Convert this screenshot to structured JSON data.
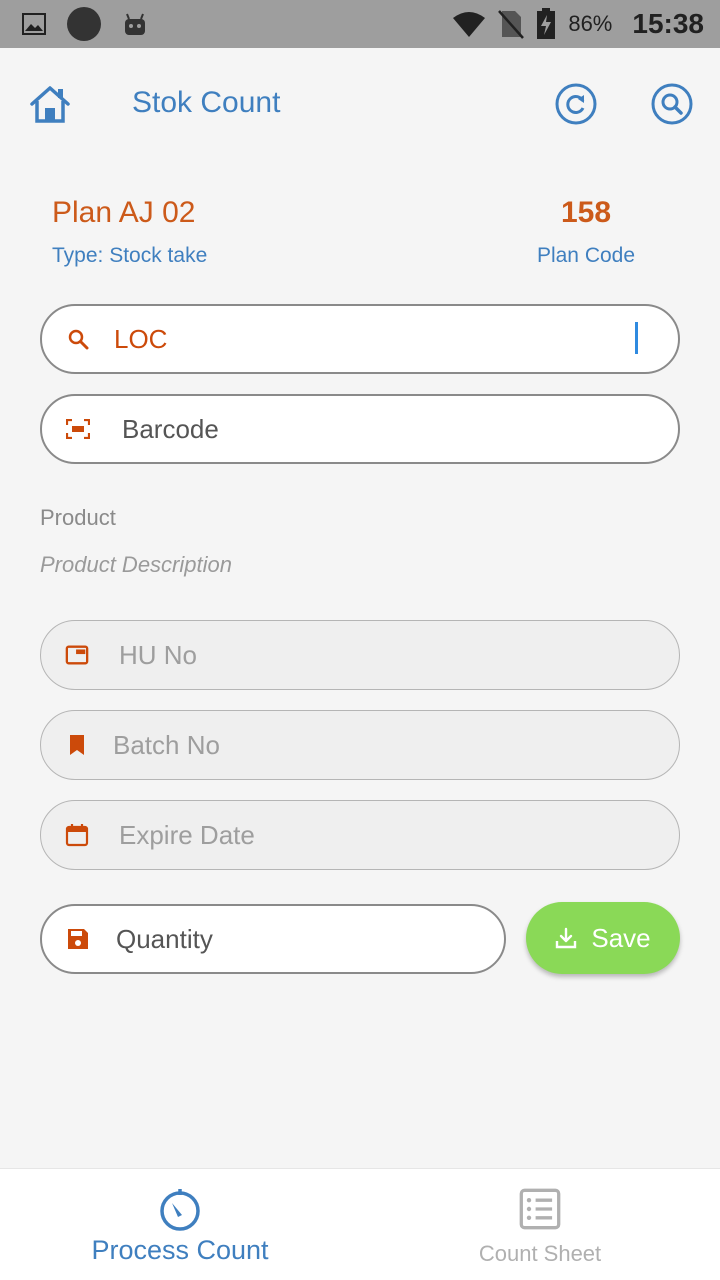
{
  "status_bar": {
    "battery_percent": "86%",
    "time": "15:38"
  },
  "app_bar": {
    "title": "Stok Count"
  },
  "plan": {
    "name": "Plan AJ 02",
    "type": "Type: Stock take",
    "code_value": "158",
    "code_label": "Plan Code"
  },
  "form": {
    "location_value": "LOC",
    "barcode_placeholder": "Barcode",
    "product_label": "Product",
    "product_description": "Product Description",
    "hu_placeholder": "HU No",
    "batch_placeholder": "Batch No",
    "expire_placeholder": "Expire Date",
    "quantity_placeholder": "Quantity",
    "save_label": "Save"
  },
  "bottom_nav": {
    "items": [
      {
        "label": "Process Count",
        "icon": "timer-icon",
        "active": true
      },
      {
        "label": "Count Sheet",
        "icon": "list-sheet-icon",
        "active": false
      }
    ]
  },
  "colors": {
    "primary_blue": "#3f7fbf",
    "accent_orange": "#cc5a1a",
    "save_green": "#8ad957"
  }
}
